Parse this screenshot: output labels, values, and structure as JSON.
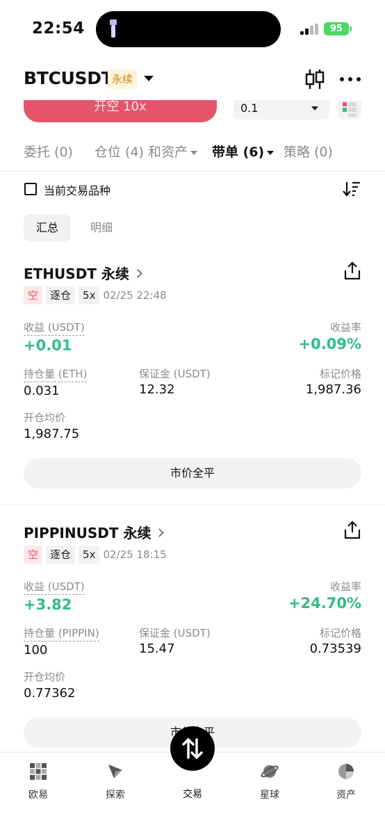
{
  "status_bar": {
    "time": "22:54",
    "battery": "95"
  },
  "header": {
    "pair": "BTCUSDT",
    "badge": "永续"
  },
  "order_strip": {
    "open_short_label": "开空 10x",
    "quantity": "0.1"
  },
  "tabs": [
    {
      "label": "委托 (0)"
    },
    {
      "label": "仓位 (4) 和资产"
    },
    {
      "label": "带单 (6)"
    },
    {
      "label": "策略 (0)"
    }
  ],
  "filter": {
    "current_pair_label": "当前交易品种"
  },
  "segments": {
    "summary": "汇总",
    "detail": "明细"
  },
  "positions": [
    {
      "symbol": "ETHUSDT 永续",
      "side_tag": "空",
      "margin_tag": "逐仓",
      "leverage_tag": "5x",
      "time": "02/25 22:48",
      "pnl_label": "收益 (USDT)",
      "pnl_value": "+0.01",
      "roi_label": "收益率",
      "roi_value": "+0.09%",
      "size_label": "持仓量 (ETH)",
      "size_value": "0.031",
      "margin_label": "保证金 (USDT)",
      "margin_value": "12.32",
      "mark_label": "标记价格",
      "mark_value": "1,987.36",
      "entry_label": "开仓均价",
      "entry_value": "1,987.75",
      "close_label": "市价全平"
    },
    {
      "symbol": "PIPPINUSDT 永续",
      "side_tag": "空",
      "margin_tag": "逐仓",
      "leverage_tag": "5x",
      "time": "02/25 18:15",
      "pnl_label": "收益 (USDT)",
      "pnl_value": "+3.82",
      "roi_label": "收益率",
      "roi_value": "+24.70%",
      "size_label": "持仓量 (PIPPIN)",
      "size_value": "100",
      "margin_label": "保证金 (USDT)",
      "margin_value": "15.47",
      "mark_label": "标记价格",
      "mark_value": "0.73539",
      "entry_label": "开仓均价",
      "entry_value": "0.77362",
      "close_label": "市价全平"
    }
  ],
  "bottom_nav": [
    {
      "label": "欧易",
      "icon": "okx-logo-icon"
    },
    {
      "label": "探索",
      "icon": "compass-icon"
    },
    {
      "label": "交易",
      "icon": "swap-arrows-icon"
    },
    {
      "label": "星球",
      "icon": "planet-icon"
    },
    {
      "label": "资产",
      "icon": "pie-chart-icon"
    }
  ],
  "colors": {
    "accent_green": "#2ebd85",
    "short_red": "#e4556b",
    "badge_gold": "#c98a14"
  }
}
